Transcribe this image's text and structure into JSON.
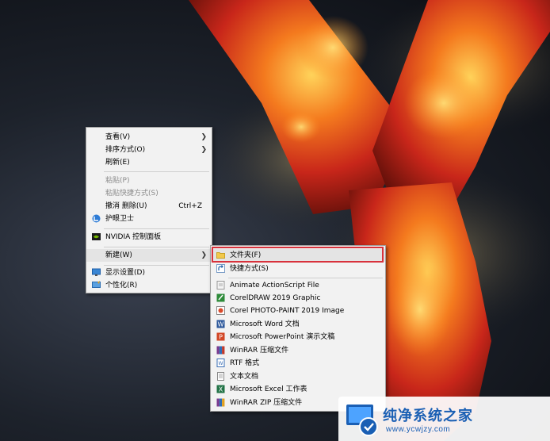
{
  "context_menu": {
    "items": [
      {
        "label": "查看(V)",
        "submenu": true
      },
      {
        "label": "排序方式(O)",
        "submenu": true
      },
      {
        "label": "刷新(E)"
      },
      {
        "label": "粘贴(P)",
        "disabled": true
      },
      {
        "label": "粘贴快捷方式(S)",
        "disabled": true
      },
      {
        "label": "撤消 删除(U)",
        "shortcut": "Ctrl+Z"
      },
      {
        "label": "护眼卫士",
        "icon": "eye-guard-icon"
      },
      {
        "label": "NVIDIA 控制面板",
        "icon": "nvidia-icon"
      },
      {
        "label": "新建(W)",
        "submenu": true
      },
      {
        "label": "显示设置(D)",
        "icon": "display-settings-icon"
      },
      {
        "label": "个性化(R)",
        "icon": "personalize-icon"
      }
    ]
  },
  "new_submenu": {
    "items": [
      {
        "label": "文件夹(F)",
        "icon": "folder-icon"
      },
      {
        "label": "快捷方式(S)",
        "icon": "shortcut-icon"
      },
      {
        "label": "Animate ActionScript File",
        "icon": "animate-icon"
      },
      {
        "label": "CorelDRAW 2019 Graphic",
        "icon": "coreldraw-icon"
      },
      {
        "label": "Corel PHOTO-PAINT 2019 Image",
        "icon": "photopaint-icon"
      },
      {
        "label": "Microsoft Word 文档",
        "icon": "word-icon"
      },
      {
        "label": "Microsoft PowerPoint 演示文稿",
        "icon": "powerpoint-icon"
      },
      {
        "label": "WinRAR 压缩文件",
        "icon": "winrar-icon"
      },
      {
        "label": "RTF 格式",
        "icon": "rtf-icon"
      },
      {
        "label": "文本文档",
        "icon": "text-document-icon"
      },
      {
        "label": "Microsoft Excel 工作表",
        "icon": "excel-icon"
      },
      {
        "label": "WinRAR ZIP 压缩文件",
        "icon": "winrar-zip-icon"
      }
    ]
  },
  "watermark": {
    "title": "纯净系统之家",
    "url": "www.ycwjzy.com"
  },
  "colors": {
    "highlight_border": "#d8323c",
    "watermark_blue": "#1a5fb4"
  }
}
